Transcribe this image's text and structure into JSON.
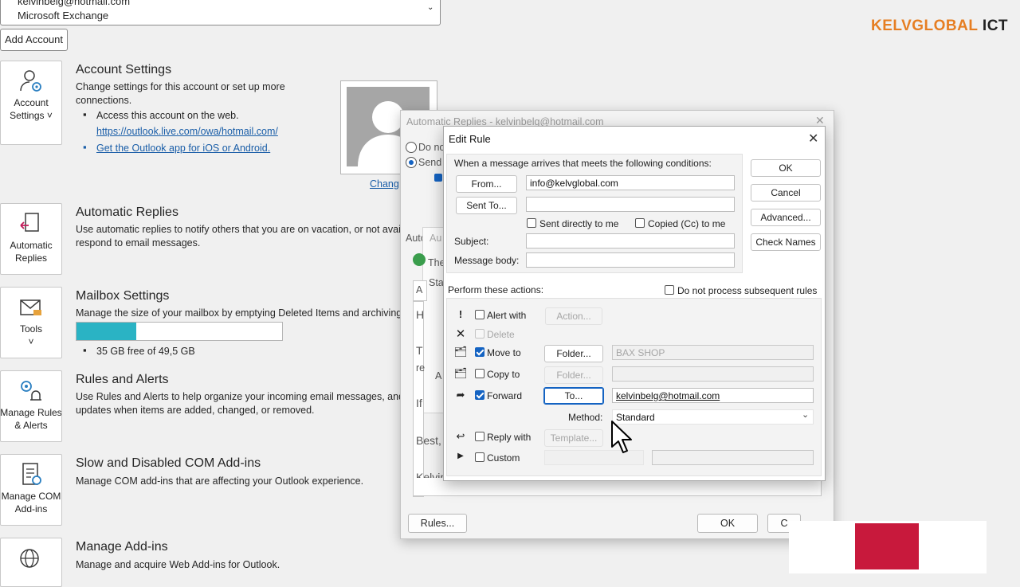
{
  "account": {
    "email": "kelvinbelg@hotmail.com",
    "type": "Microsoft Exchange",
    "add_account_label": "Add Account"
  },
  "brand": {
    "part1": "KELVGLOBAL",
    "part2": "ICT",
    "accent": "#e67e22"
  },
  "tiles": [
    {
      "line1": "Account",
      "line2": "Settings ˅",
      "icon": "account-settings-icon"
    },
    {
      "line1": "Automatic",
      "line2": "Replies",
      "icon": "automatic-replies-icon"
    },
    {
      "line1": "Tools",
      "line2": "˅",
      "icon": "tools-icon"
    },
    {
      "line1": "Manage Rules",
      "line2": "& Alerts",
      "icon": "rules-alerts-icon"
    },
    {
      "line1": "Manage COM",
      "line2": "Add-ins",
      "icon": "com-addins-icon"
    },
    {
      "line1": "",
      "line2": "",
      "icon": "globe-icon"
    }
  ],
  "sections": {
    "account_settings": {
      "title": "Account Settings",
      "desc": "Change settings for this account or set up more connections.",
      "bullet1": "Access this account on the web.",
      "link1": "https://outlook.live.com/owa/hotmail.com/",
      "link2": "Get the Outlook app for iOS or Android."
    },
    "automatic_replies": {
      "title": "Automatic Replies",
      "desc1": "Use automatic replies to notify others that you are on vacation, or not avai",
      "desc2": "respond to email messages."
    },
    "mailbox": {
      "title": "Mailbox Settings",
      "desc": "Manage the size of your mailbox by emptying Deleted Items and archiving",
      "storage_text": "35 GB free of 49,5 GB",
      "used_fraction": 0.29
    },
    "rules": {
      "title": "Rules and Alerts",
      "desc1": "Use Rules and Alerts to help organize your incoming email messages, and",
      "desc2": "updates when items are added, changed, or removed."
    },
    "com": {
      "title": "Slow and Disabled COM Add-ins",
      "desc": "Manage COM add-ins that are affecting your Outlook experience."
    },
    "addins": {
      "title": "Manage Add-ins",
      "desc": "Manage and acquire Web Add-ins for Outlook."
    }
  },
  "photo": {
    "change_label": "Chang"
  },
  "auto_replies_dialog": {
    "title": "Automatic Replies - kelvinbelg@hotmail.com",
    "radio_off": "Do no",
    "radio_on": "Send",
    "ghost_auto": "Auto",
    "ghost_au": "Au",
    "ghost_the": "The",
    "ghost_sta": "Sta",
    "ghost_a": "A",
    "ghost_h": "H",
    "ghost_t": "T",
    "ghost_re": "re",
    "ghost_a2": "A",
    "ghost_if": "If",
    "ghost_best": "Best,",
    "ghost_kelvin": "Kelvin",
    "rules_btn": "Rules...",
    "ok_btn": "OK",
    "cancel_btn": "C"
  },
  "edit_rule": {
    "title": "Edit Rule",
    "conditions_header": "When a message arrives that meets the following conditions:",
    "from_btn": "From...",
    "from_value": "info@kelvglobal.com",
    "sent_to_btn": "Sent To...",
    "sent_to_value": "",
    "sent_directly": "Sent directly to me",
    "copied_cc": "Copied (Cc) to me",
    "subject_label": "Subject:",
    "subject_value": "",
    "body_label": "Message body:",
    "body_value": "",
    "ok": "OK",
    "cancel": "Cancel",
    "advanced": "Advanced...",
    "check_names": "Check Names",
    "actions_header": "Perform these actions:",
    "do_not_process": "Do not process subsequent rules",
    "actions": [
      {
        "label": "Alert with",
        "button": "Action...",
        "icon": "exclamation-icon",
        "checked": false
      },
      {
        "label": "Delete",
        "icon": "delete-x-icon",
        "checked": false
      },
      {
        "label": "Move to",
        "button": "Folder...",
        "value": "BAX SHOP",
        "icon": "move-folder-icon",
        "checked": true
      },
      {
        "label": "Copy to",
        "button": "Folder...",
        "value": "",
        "icon": "copy-folder-icon",
        "checked": false
      },
      {
        "label": "Forward",
        "button": "To...",
        "value": "kelvinbelg@hotmail.com",
        "icon": "forward-icon",
        "checked": true
      },
      {
        "label": "Reply with",
        "button": "Template...",
        "icon": "reply-icon",
        "checked": false
      },
      {
        "label": "Custom",
        "icon": "expand-arrow-icon",
        "checked": false
      }
    ],
    "method_label": "Method:",
    "method_value": "Standard"
  }
}
